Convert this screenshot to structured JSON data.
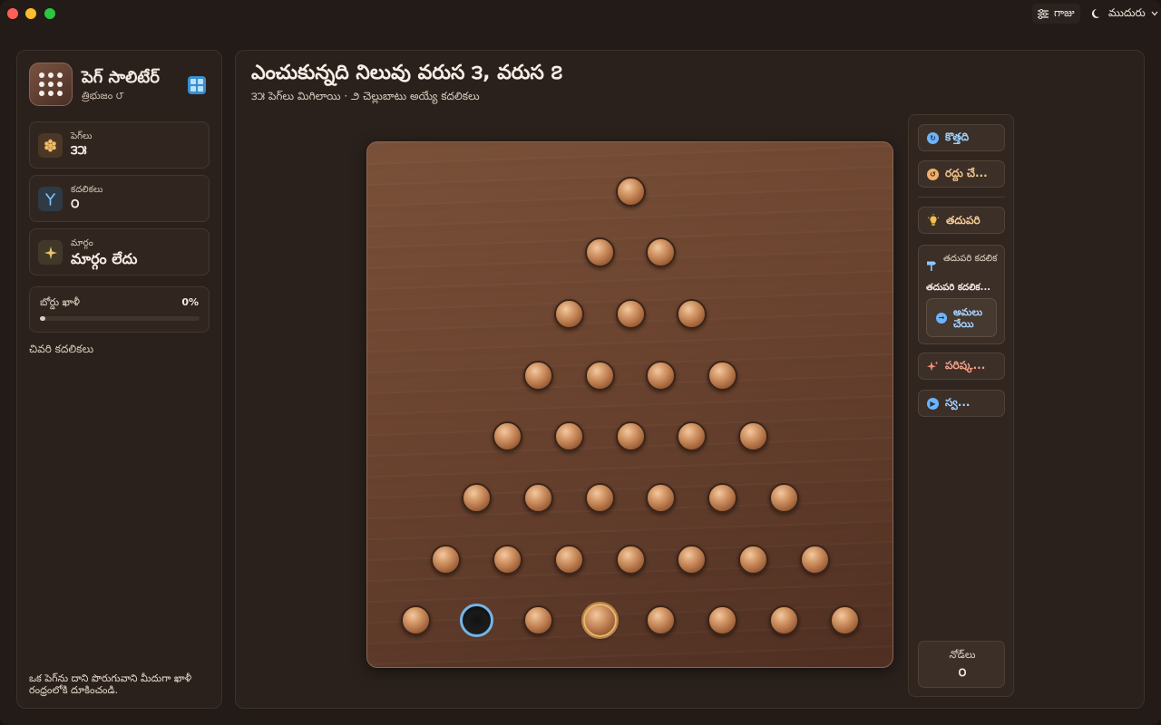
{
  "titlebar": {
    "settings_label": "గాజు",
    "theme_label": "ముదురు"
  },
  "sidebar": {
    "app_title": "పెగ్ సాలిటేర్",
    "app_subtitle": "త్రిభుజం ౮",
    "stats": {
      "pegs_label": "పెగ్‌లు",
      "pegs_value": "౩౫",
      "moves_label": "కదలికలు",
      "moves_value": "౦",
      "path_label": "మార్గం",
      "path_value": "మార్గం లేదు"
    },
    "progress": {
      "label": "బోర్డు ఖాళీ",
      "percent_text": "0%",
      "value": 0
    },
    "recent_moves_title": "చివరి కదలికలు",
    "hint_text": "ఒక పెగ్‌ను దాని పొరుగువాని మీదుగా ఖాళీ రంధ్రంలోకి దూకించండి."
  },
  "main": {
    "title": "ఎంచుకున్నది నిలువు వరుస ౩, వరుస ౭",
    "subtitle": "౩౫ పెగ్‌లు మిగిలాయి · ౨ చెల్లుబాటు అయ్యే కదలికలు"
  },
  "board": {
    "rows": 8,
    "empty": [
      [
        7,
        1
      ]
    ],
    "selected": [
      [
        7,
        3
      ]
    ]
  },
  "rail": {
    "new_label": "కొత్తది",
    "undo_label": "రద్దు చే...",
    "hint_label": "తదుపరి",
    "next_move_title": "తదుపరి కదలిక",
    "next_move_value": "తదుపరి కదలిక...",
    "apply_label": "అమలు చేయి",
    "solve_label": "పరిష్క...",
    "auto_label": "స్వ...",
    "nodes_label": "నోడ్‌లు",
    "nodes_value": "౦"
  },
  "colors": {
    "accent_blue": "#6cb4ff",
    "accent_orange": "#f0b06a",
    "board_wood": "#6a432f",
    "peg": "#c98a5a"
  }
}
